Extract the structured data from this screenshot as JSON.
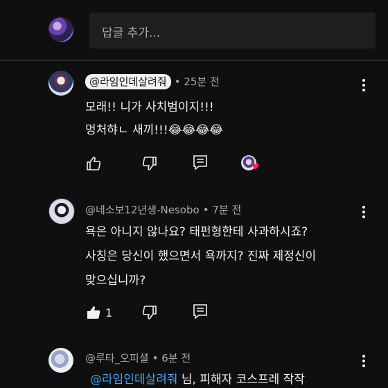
{
  "composer": {
    "placeholder": "답글 추가..."
  },
  "comments": [
    {
      "author": "@라임인데살려줘",
      "time": "• 25분 전",
      "lines": [
        "모래!! 니가 사치범이지!!!",
        "멍처햐ㄴ 새끼!!!😂😂😂😂"
      ],
      "likes": "",
      "creator_heart": true
    },
    {
      "author": "@네소보12년생-Nesobo",
      "time": "• 7분 전",
      "lines": [
        "욕은 아니지 않나요? 태펀형한테 사과하시죠?",
        "사칭은 당신이 했으면서 욕까지? 진짜 제정신이",
        "맞으십니까?"
      ],
      "likes": "1"
    },
    {
      "author": "@루타_오피셜",
      "time": "• 6분 전",
      "mention": "@라임인데살려줘",
      "lines": [
        "님, 피해자 코스프레 작작"
      ]
    }
  ],
  "icons": {
    "like": "thumbs-up-icon",
    "dislike": "thumbs-down-icon",
    "reply": "reply-icon",
    "menu": "more-vertical-icon",
    "heart": "heart-icon"
  },
  "colors": {
    "background": "#0f0f0f",
    "mention": "#3ea6ff",
    "heart": "#ff2244"
  }
}
